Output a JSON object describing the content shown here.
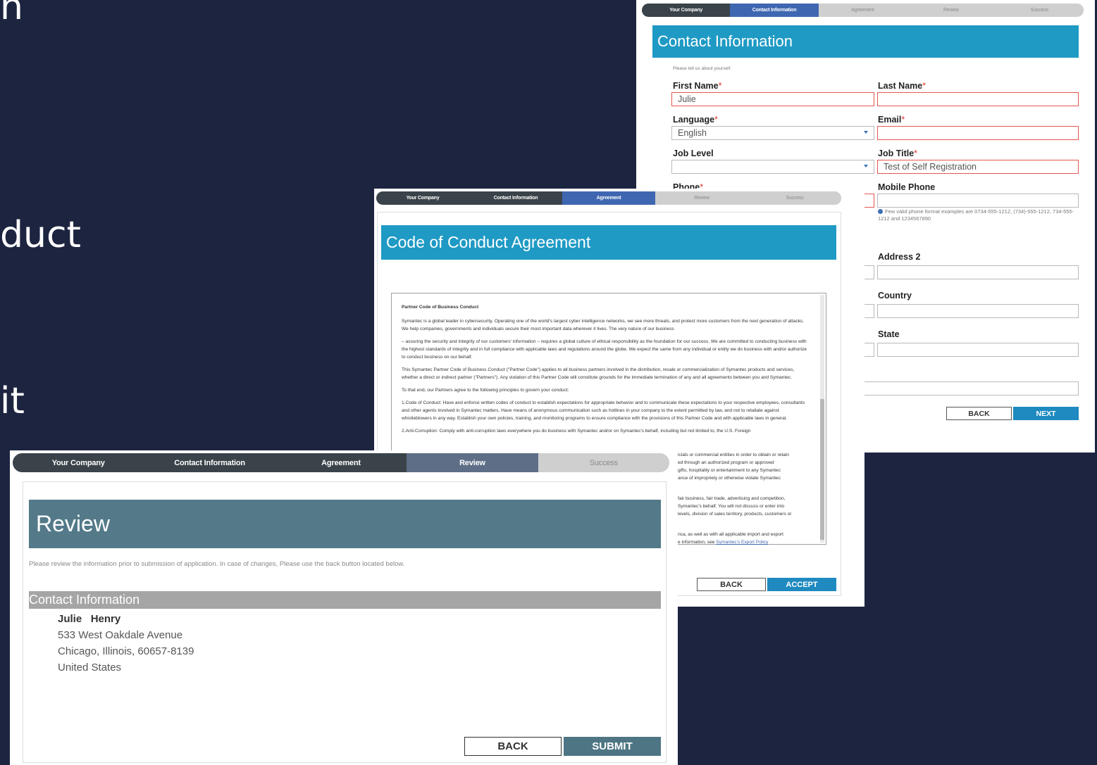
{
  "background_text": [
    "n",
    "duct",
    "it"
  ],
  "contact_shot": {
    "steps": [
      "Your Company",
      "Contact Information",
      "Agreement",
      "Review",
      "Success"
    ],
    "title": "Contact Information",
    "intro": "Please tell us about yourself.",
    "fields": {
      "first_name": {
        "label": "First Name",
        "value": "Julie"
      },
      "last_name": {
        "label": "Last Name",
        "value": ""
      },
      "language": {
        "label": "Language",
        "value": "English"
      },
      "email": {
        "label": "Email",
        "value": ""
      },
      "job_level": {
        "label": "Job Level",
        "value": ""
      },
      "job_title": {
        "label": "Job Title",
        "value": "Test of Self Registration"
      },
      "phone": {
        "label": "Phone"
      },
      "mobile_phone": {
        "label": "Mobile Phone",
        "value": ""
      },
      "address2": {
        "label": "Address 2",
        "value": ""
      },
      "country": {
        "label": "Country",
        "value": ""
      },
      "state": {
        "label": "State",
        "value": ""
      }
    },
    "required_mark": "*",
    "phone_hint": "Few valid phone format examples are 0734-555-1212, (734)-555-1212, 734-555-1212 and 1234567890",
    "back": "BACK",
    "next": "NEXT"
  },
  "conduct_shot": {
    "steps": [
      "Your Company",
      "Contact Information",
      "Agreement",
      "Review",
      "Success"
    ],
    "title": "Code of Conduct Agreement",
    "heading": "Partner Code of Business Conduct",
    "paragraphs": [
      "Symantec is a global leader in cybersecurity. Operating one of the world's largest cyber intelligence networks, we see more threats, and protect more customers from the next generation of attacks. We help companies, governments and individuals secure their most important data wherever it lives. The very nature of our business",
      "– assuring the security and integrity of our customers' information – requires a global culture of ethical responsibility as the foundation for our success. We are committed to conducting business with the highest standards of integrity and in full compliance with applicable laws and regulations around the globe. We expect the same from any individual or entity we do business with and/or authorize to conduct business on our behalf.",
      "This Symantec Partner Code of Business Conduct (\"Partner Code\") applies to all business partners involved in the distribution, resale or commercialization of Symantec products and services, whether a direct or indirect partner (\"Partners\"). Any violation of this Partner Code will constitute grounds for the immediate termination of any and all agreements between you and Symantec.",
      "To that end, our Partners agree to the following principles to govern your conduct:",
      "1.Code of Conduct: Have and enforce written codes of conduct to establish expectations for appropriate behavior and to communicate these expectations to your respective employees, consultants and other agents involved in Symantec matters. Have means of anonymous communication such as hotlines in your company to the extent permitted by law, and not to retaliate against whistleblowers in any way. Establish your own policies, training, and monitoring programs to ensure compliance with the provisions of this Partner Code and with applicable laws in general.",
      "2.Anti-Corruption: Comply with anti-corruption laws everywhere you do business with Symantec and/or on Symantec's behalf, including but not limited to, the U.S. Foreign"
    ],
    "partial_lines": [
      "icials or commercial entities in order to obtain or retain",
      "ed through an authorized program or approved",
      "gifts, hospitality or entertainment to any Symantec",
      "ance of impropriety or otherwise violate Symantec",
      "fair business, fair trade, advertising and competition,",
      "Symantec's behalf. You will not discuss or enter into",
      "levels, division of sales territory, products, customers or",
      "rica, as well as with all applicable import and export"
    ],
    "partial_link_prefix": "e information, see ",
    "partial_link": "Symantec's Export Policy",
    "back": "BACK",
    "accept": "ACCEPT"
  },
  "review_shot": {
    "steps": [
      "Your Company",
      "Contact Information",
      "Agreement",
      "Review",
      "Success"
    ],
    "title": "Review",
    "subtitle": "Please review the information prior to submission of application. In case of changes, Please use the back button located below.",
    "section": "Contact Information",
    "name_first": "Julie",
    "name_last": "Henry",
    "street": "533 West Oakdale Avenue",
    "city_line": "Chicago,  Illinois,  60657-8139",
    "country": "United States",
    "back": "BACK",
    "submit": "SUBMIT"
  },
  "colors": {
    "background": "#1c2440",
    "banner_blue": "#1f9ac4",
    "banner_slate": "#547a89",
    "step_done": "#3a4349",
    "step_active": "#3f67b1",
    "required": "#e0332c"
  }
}
